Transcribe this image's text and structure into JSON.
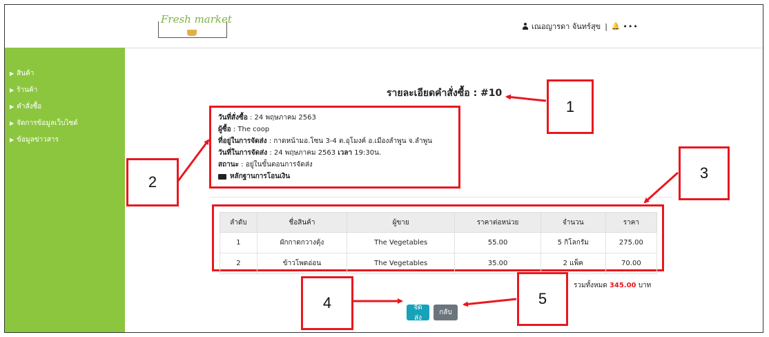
{
  "header": {
    "logo_text": "Fresh market",
    "user_name": "เณอญารดา จันทร์สุข",
    "separator": "|",
    "more": "•••"
  },
  "sidebar": {
    "items": [
      {
        "label": "สินค้า"
      },
      {
        "label": "ร้านค้า"
      },
      {
        "label": "คำสั่งซื้อ"
      },
      {
        "label": "จัดการข้อมูลเว็บไซต์"
      },
      {
        "label": "ข้อมูลข่าวสาร"
      }
    ]
  },
  "order": {
    "title": "รายละเอียดคำสั่งซื้อ : #10",
    "info": [
      {
        "label": "วันที่สั่งซื้อ",
        "value": " : 24 พฤษภาคม 2563"
      },
      {
        "label": "ผู้ซื้อ",
        "value": " : The coop"
      },
      {
        "label": "ที่อยู่ในการจัดส่ง",
        "value": " : กาดหน้ามอ.โซน 3-4 ต.อุโมงค์ อ.เมืองลำพูน จ.ลำพูน"
      },
      {
        "label": "สถานะ",
        "value": " : อยู่ในขั้นตอนการจัดส่ง"
      }
    ],
    "delivery_label": "วันที่ในการจัดส่ง",
    "delivery_value": " : 24 พฤษภาคม 2563 ",
    "time_label": "เวลา",
    "time_value": " 19:30น.",
    "evidence_label": "หลักฐานการโอนเงิน"
  },
  "table": {
    "headers": [
      "ลำดับ",
      "ชื่อสินค้า",
      "ผู้ขาย",
      "ราคาต่อหน่วย",
      "จำนวน",
      "ราคา"
    ],
    "rows": [
      [
        "1",
        "ผักกาดกวางตุ้ง",
        "The Vegetables",
        "55.00",
        "5 กิโลกรัม",
        "275.00"
      ],
      [
        "2",
        "ข้าวโพดอ่อน",
        "The Vegetables",
        "35.00",
        "2 แพ็ค",
        "70.00"
      ]
    ]
  },
  "total": {
    "prefix": "รวมทั้งหมด ",
    "amount": "345.00",
    "suffix": " บาท"
  },
  "buttons": {
    "ship": "จัดส่ง",
    "back": "กลับ"
  },
  "callouts": [
    "1",
    "2",
    "3",
    "4",
    "5"
  ],
  "colors": {
    "sidebar": "#8cc63f",
    "annotation": "#e8171f",
    "ship_button": "#17a2b8",
    "back_button": "#6c757d"
  }
}
